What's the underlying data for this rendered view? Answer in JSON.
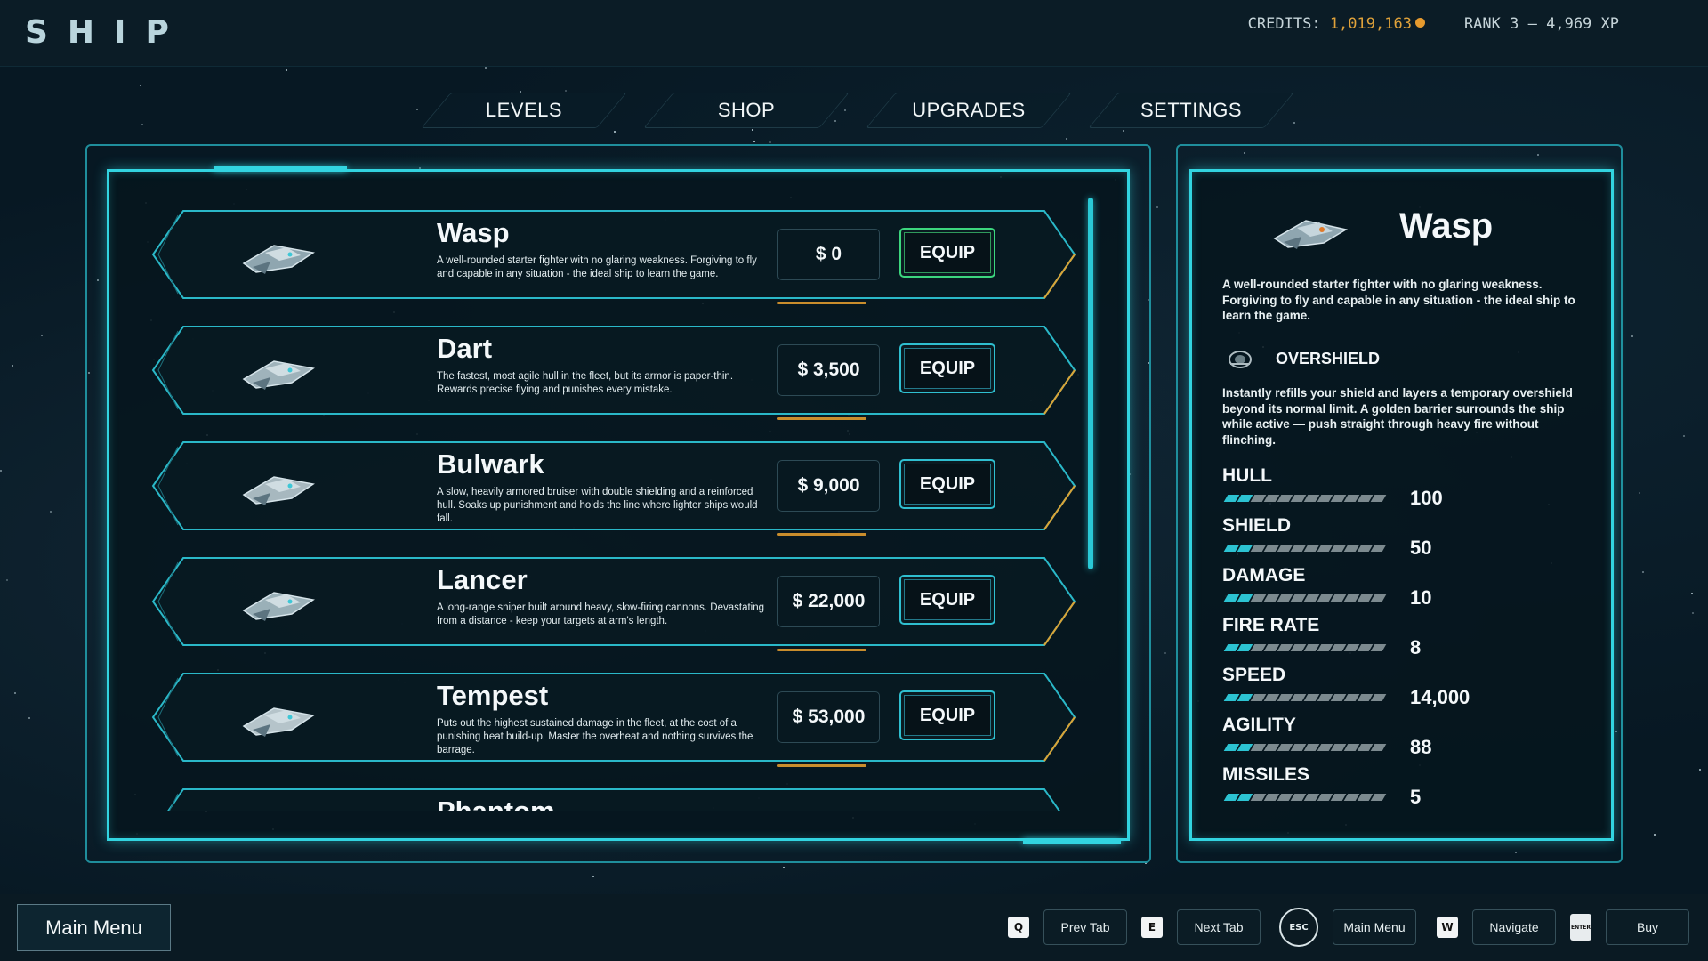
{
  "header": {
    "logo": "SHIP",
    "credits_label": "CREDITS:",
    "credits_value": "1,019,163",
    "rank_label": "RANK 3",
    "rank_sep": "—",
    "xp": "4,969 XP"
  },
  "tabs": [
    {
      "label": "LEVELS"
    },
    {
      "label": "SHOP"
    },
    {
      "label": "UPGRADES"
    },
    {
      "label": "SETTINGS"
    }
  ],
  "ships": [
    {
      "name": "Wasp",
      "description": "A well-rounded starter fighter with no glaring weakness. Forgiving to fly and capable in any situation - the ideal ship to learn the game.",
      "price": "$ 0",
      "action": "EQUIP",
      "equipped": true
    },
    {
      "name": "Dart",
      "description": "The fastest, most agile hull in the fleet, but its armor is paper-thin. Rewards precise flying and punishes every mistake.",
      "price": "$ 3,500",
      "action": "EQUIP",
      "equipped": false
    },
    {
      "name": "Bulwark",
      "description": "A slow, heavily armored bruiser with double shielding and a reinforced hull. Soaks up punishment and holds the line where lighter ships would fall.",
      "price": "$ 9,000",
      "action": "EQUIP",
      "equipped": false
    },
    {
      "name": "Lancer",
      "description": "A long-range sniper built around heavy, slow-firing cannons. Devastating from a distance - keep your targets at arm's length.",
      "price": "$ 22,000",
      "action": "EQUIP",
      "equipped": false
    },
    {
      "name": "Tempest",
      "description": "Puts out the highest sustained damage in the fleet, at the cost of a punishing heat build-up. Master the overheat and nothing survives the barrage.",
      "price": "$ 53,000",
      "action": "EQUIP",
      "equipped": false
    },
    {
      "name": "Phantom",
      "description": "",
      "price": "",
      "action": "",
      "equipped": false
    }
  ],
  "detail": {
    "name": "Wasp",
    "description": "A well-rounded starter fighter with no glaring weakness. Forgiving to fly and capable in any situation - the ideal ship to learn the game.",
    "ability_icon": "shield-emblem-icon",
    "ability_name": "OVERSHIELD",
    "ability_description": "Instantly refills your shield and layers a temporary overshield beyond its normal limit. A golden barrier surrounds the ship while active — push straight through heavy fire without flinching.",
    "stats": [
      {
        "label": "HULL",
        "value": "100",
        "fill": 0.2
      },
      {
        "label": "SHIELD",
        "value": "50",
        "fill": 0.2
      },
      {
        "label": "DAMAGE",
        "value": "10",
        "fill": 0.2
      },
      {
        "label": "FIRE RATE",
        "value": "8",
        "fill": 0.2
      },
      {
        "label": "SPEED",
        "value": "14,000",
        "fill": 0.2
      },
      {
        "label": "AGILITY",
        "value": "88",
        "fill": 0.2
      },
      {
        "label": "MISSILES",
        "value": "5",
        "fill": 0.2
      }
    ]
  },
  "footer": {
    "main_menu": "Main Menu",
    "hints": [
      {
        "key": "Q",
        "label": "Prev Tab"
      },
      {
        "key": "E",
        "label": "Next Tab"
      },
      {
        "key": "ESC",
        "label": "Main Menu"
      },
      {
        "key": "W",
        "label": "Navigate"
      },
      {
        "key": "ENTER",
        "label": "Buy"
      }
    ]
  },
  "colors": {
    "accent": "#32d4e0",
    "equipped": "#3cd67e",
    "gold": "#e0a23a"
  }
}
